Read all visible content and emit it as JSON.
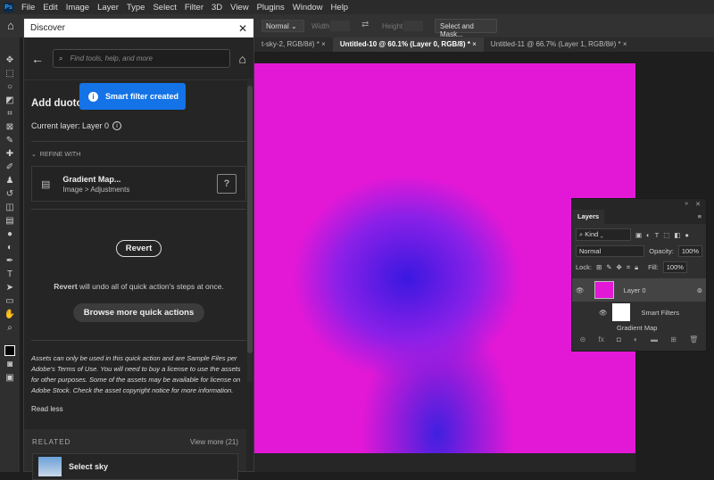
{
  "menu": {
    "logo": "Ps",
    "items": [
      "File",
      "Edit",
      "Image",
      "Layer",
      "Type",
      "Select",
      "Filter",
      "3D",
      "View",
      "Plugins",
      "Window",
      "Help"
    ]
  },
  "options": {
    "style": "Normal",
    "width_label": "Width:",
    "height_label": "Height:",
    "select_mask": "Select and Mask..."
  },
  "tabs": [
    {
      "label": "t-sky-2, RGB/8#) *"
    },
    {
      "label": "Untitled-10 @ 60.1% (Layer 0, RGB/8) *"
    },
    {
      "label": "Untitled-11 @ 66.7% (Layer 1, RGB/8#) *"
    }
  ],
  "discover": {
    "title": "Discover",
    "search_placeholder": "Find tools, help, and more",
    "heading": "Add duotone",
    "toast": "Smart filter created",
    "current_layer": "Current layer: Layer 0",
    "refine_label": "REFINE WITH",
    "refine_item": {
      "title": "Gradient Map...",
      "path": "Image > Adjustments"
    },
    "revert": "Revert",
    "revert_note_bold": "Revert",
    "revert_note": " will undo all of quick action's steps at once.",
    "browse": "Browse more quick actions",
    "legal": {
      "p1": "Assets can only be used in this quick action and are Sample Files per ",
      "link1": "Adobe's Terms of Use",
      "p2": ". You will need to buy a license to use the assets for other purposes. Some of the assets may be available for license on ",
      "link2": "Adobe Stock",
      "p3": ". Check the asset copyright notice for more information."
    },
    "read_less": "Read less",
    "related": "RELATED",
    "view_more": "View more (21)",
    "related_item": "Select sky"
  },
  "layers": {
    "title": "Layers",
    "kind": "Kind",
    "blend": "Normal",
    "opacity_label": "Opacity:",
    "opacity": "100%",
    "lock_label": "Lock:",
    "fill_label": "Fill:",
    "fill": "100%",
    "layer0": "Layer 0",
    "smart_filters": "Smart Filters",
    "gradient_map": "Gradient Map"
  },
  "colors": {
    "accent": "#1473e6",
    "canvas": "#e318d6"
  }
}
